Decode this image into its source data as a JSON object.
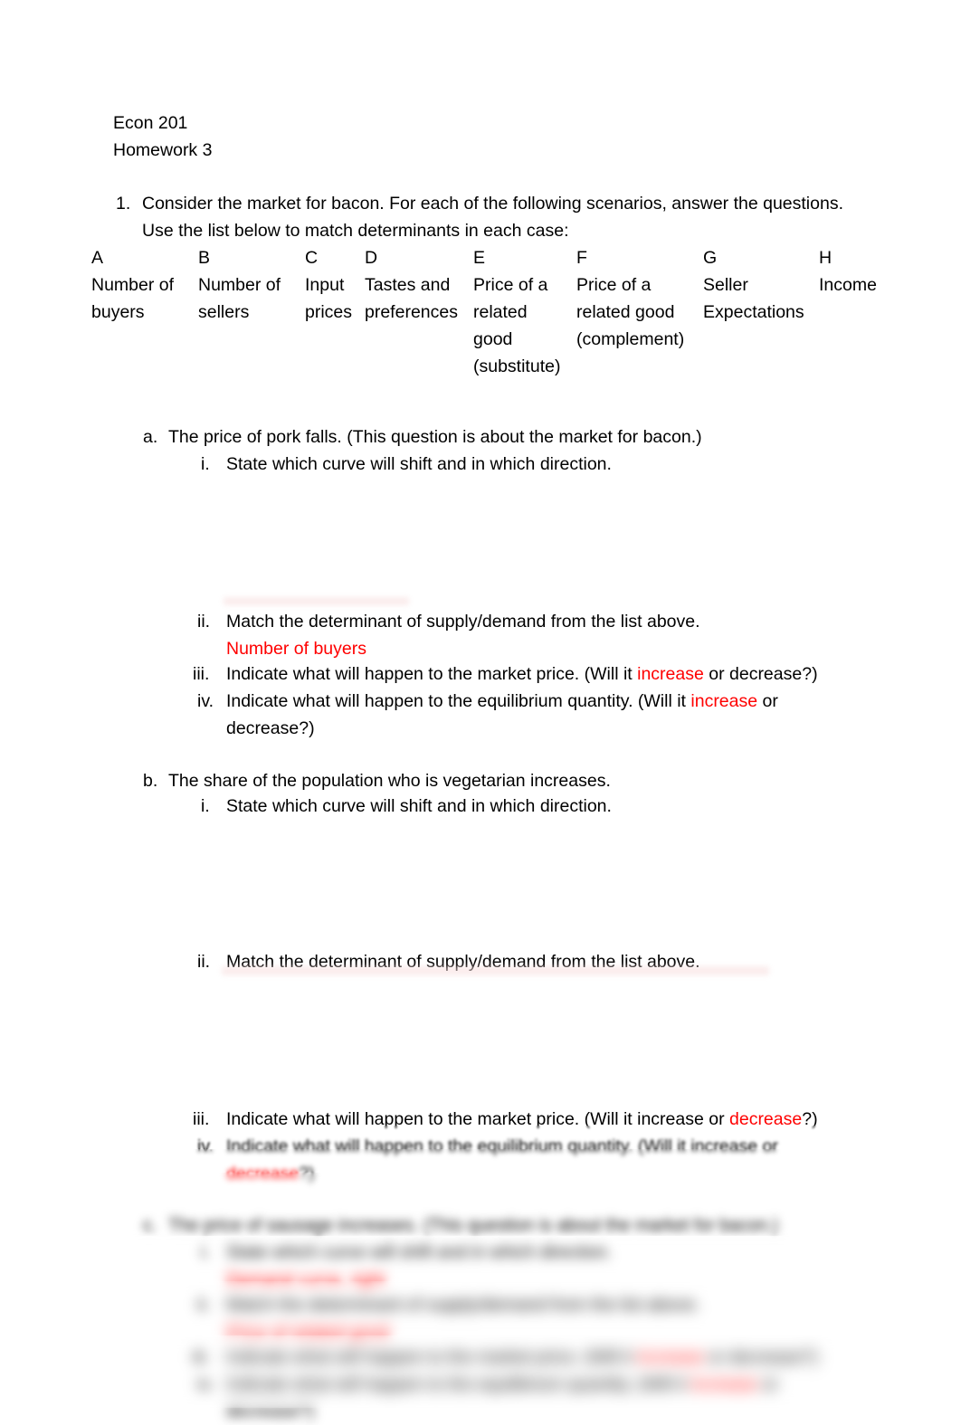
{
  "document": {
    "header": {
      "course": "Econ 201",
      "assignment": "Homework 3"
    },
    "question_1": {
      "marker": "1.",
      "line_1": "Consider the market for bacon.  For each of the following scenarios, answer the questions.",
      "line_2": "Use the list below to match determinants in each case:"
    },
    "determinants": [
      {
        "letter": "A",
        "name": "Number of buyers"
      },
      {
        "letter": "B",
        "name": "Number of sellers"
      },
      {
        "letter": "C",
        "name": "Input prices"
      },
      {
        "letter": "D",
        "name": "Tastes and preferences"
      },
      {
        "letter": "E",
        "name": "Price of a related good (substitute)"
      },
      {
        "letter": "F",
        "name": "Price of a related good (complement)"
      },
      {
        "letter": "G",
        "name": "Seller Expectations"
      },
      {
        "letter": "H",
        "name": "Income"
      }
    ],
    "part_a": {
      "marker": "a.",
      "prompt": "The price of pork falls. (This question is about the market for bacon.)",
      "i": {
        "marker": "i.",
        "text": "State which curve will shift and in which direction."
      },
      "ii": {
        "marker": "ii.",
        "text": "Match the determinant of supply/demand from the list above.",
        "answer": "Number of buyers"
      },
      "iii": {
        "marker": "iii.",
        "text_before": "Indicate what will happen to the market price. (Will it ",
        "answer": "increase",
        "text_after": " or decrease?)"
      },
      "iv": {
        "marker": "iv.",
        "text_before": "Indicate what will happen to the equilibrium quantity. (Will it ",
        "answer": "increase",
        "text_after": " or decrease?)"
      }
    },
    "part_b": {
      "marker": "b.",
      "prompt": "The share of the population who is vegetarian increases.",
      "i": {
        "marker": "i.",
        "text": "State which curve will shift and in which direction."
      },
      "ii": {
        "marker": "ii.",
        "text": "Match the determinant of supply/demand from the list above."
      },
      "iii": {
        "marker": "iii.",
        "text_before": "Indicate what will happen to the market price. (Will it increase or ",
        "answer": "decrease",
        "text_after": "?)"
      },
      "iv": {
        "marker": "iv.",
        "text_before": "Indicate what will happen to the equilibrium quantity. (Will it increase or ",
        "answer": "decrease",
        "text_after": "?)"
      }
    },
    "part_c": {
      "marker": "c.",
      "prompt": "The price of sausage increases.  (This question is about the market for bacon.)",
      "i": {
        "marker": "i.",
        "text": "State which curve will shift and in which direction.",
        "answer": "Demand curve, right"
      },
      "ii": {
        "marker": "ii.",
        "text": "Match the determinant of supply/demand from the list above.",
        "answer": "Price of related good"
      },
      "iii": {
        "marker": "iii.",
        "text_before": "Indicate what will happen to the market price. (Will it ",
        "answer": "increase",
        "text_after": " or decrease?)"
      },
      "iv": {
        "marker": "iv.",
        "text_before": "Indicate what will happen to the equilibrium quantity. (Will it ",
        "answer": "increase",
        "text_after": " or decrease?)"
      }
    },
    "colors": {
      "answer_red": "#ff0000",
      "page_background": "#ffffff",
      "body_text": "#000000"
    }
  }
}
